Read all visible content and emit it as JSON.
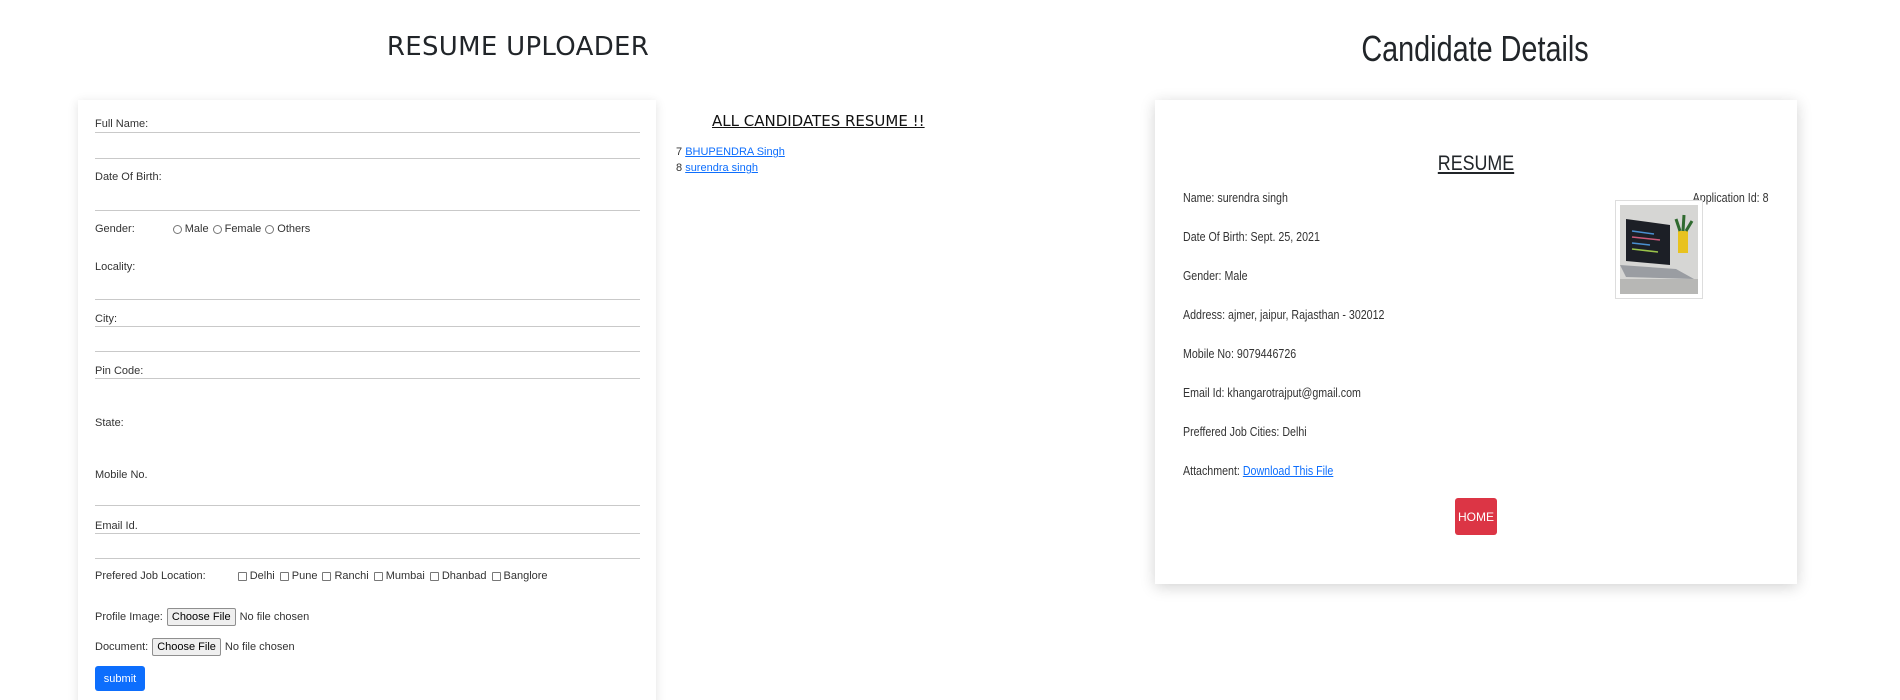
{
  "uploader": {
    "title": "RESUME UPLOADER",
    "labels": {
      "full_name": "Full Name:",
      "dob": "Date Of Birth:",
      "gender": "Gender:",
      "locality": "Locality:",
      "city": "City:",
      "pin": "Pin Code:",
      "state": "State:",
      "mobile": "Mobile No.",
      "email": "Email Id.",
      "job_location": "Prefered Job Location:",
      "profile_image": "Profile Image:",
      "document": "Document:"
    },
    "gender_options": [
      "Male",
      "Female",
      "Others"
    ],
    "location_options": [
      "Delhi",
      "Pune",
      "Ranchi",
      "Mumbai",
      "Dhanbad",
      "Banglore"
    ],
    "file_button": "Choose File",
    "file_status": "No file chosen",
    "submit": "submit"
  },
  "candidates": {
    "title": "ALL CANDIDATES RESUME !!",
    "items": [
      {
        "id": "7",
        "name": "BHUPENDRA Singh"
      },
      {
        "id": "8",
        "name": "surendra singh"
      }
    ]
  },
  "details": {
    "title": "Candidate Details",
    "resume_heading": "RESUME",
    "application_id": "Application Id: 8",
    "name": "Name: surendra singh",
    "dob": "Date Of Birth: Sept. 25, 2021",
    "gender": "Gender: Male",
    "address": "Address: ajmer, jaipur, Rajasthan - 302012",
    "mobile": "Mobile No: 9079446726",
    "email": "Email Id: khangarotrajput@gmail.com",
    "cities": "Preffered Job Cities: Delhi",
    "attachment_label": "Attachment:",
    "attachment_link": "Download This File",
    "home": "HOME"
  },
  "colors": {
    "primary": "#0d6efd",
    "danger": "#dc3545"
  }
}
